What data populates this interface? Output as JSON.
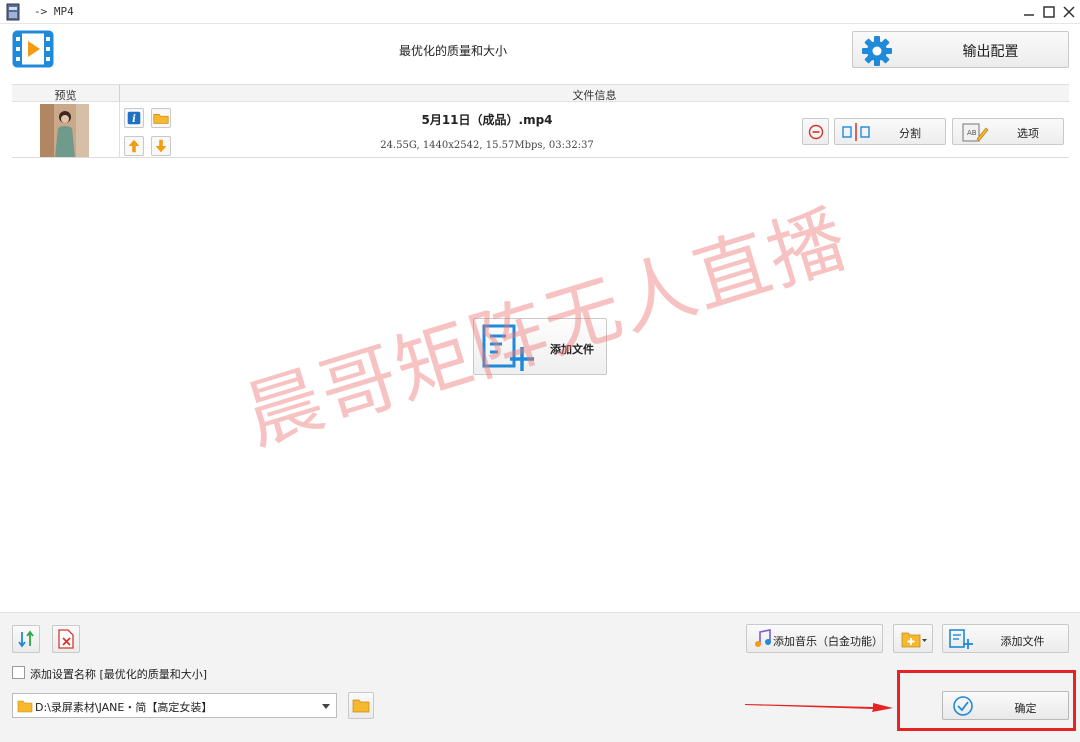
{
  "window": {
    "title": "-> MP4"
  },
  "header": {
    "profile_title": "最优化的质量和大小",
    "output_config_label": "输出配置"
  },
  "list": {
    "columns": {
      "preview": "预览",
      "file_info": "文件信息"
    },
    "files": [
      {
        "name": "5月11日（成品）.mp4",
        "meta": "24.55G, 1440x2542, 15.57Mbps, 03:32:37",
        "split_label": "分割",
        "options_label": "选项"
      }
    ]
  },
  "center": {
    "add_file_label": "添加文件"
  },
  "watermark": {
    "text": "晨哥矩阵无人直播"
  },
  "bottom": {
    "add_music_label": "添加音乐（白金功能）",
    "add_file_label": "添加文件",
    "add_setting_name_label": "添加设置名称 [最优化的质量和大小]",
    "output_path": "D:\\录屏素材\\JANE・简【高定女装】",
    "confirm_label": "确定"
  },
  "colors": {
    "accent_blue": "#1f8ad9",
    "annotation_red": "#e62222",
    "watermark": "#ee7878",
    "orange": "#f39c12"
  }
}
